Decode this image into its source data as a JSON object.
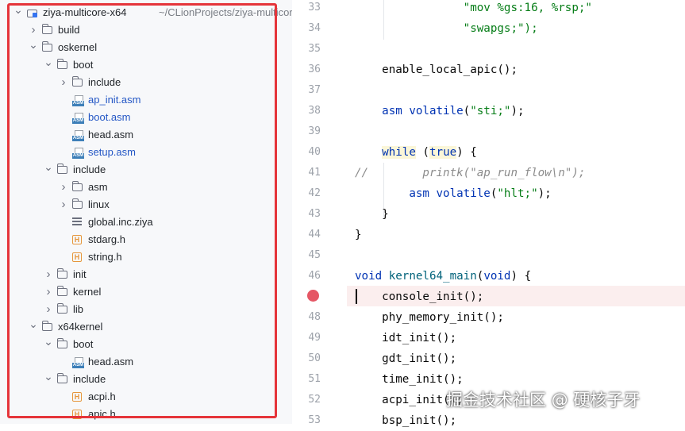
{
  "project_tree": {
    "root_name": "ziya-multicore-x64",
    "root_path": "~/CLionProjects/ziya-multicore",
    "rows": [
      {
        "depth": 0,
        "arrow": "down",
        "icon": "module-icon",
        "label": "ziya-multicore-x64",
        "style": "normal"
      },
      {
        "depth": 1,
        "arrow": "right",
        "icon": "folder-icon",
        "label": "build",
        "style": "normal"
      },
      {
        "depth": 1,
        "arrow": "down",
        "icon": "folder-icon",
        "label": "oskernel",
        "style": "normal"
      },
      {
        "depth": 2,
        "arrow": "down",
        "icon": "folder-icon",
        "label": "boot",
        "style": "normal"
      },
      {
        "depth": 3,
        "arrow": "right",
        "icon": "folder-icon",
        "label": "include",
        "style": "normal"
      },
      {
        "depth": 3,
        "arrow": "none",
        "icon": "asm-file-icon",
        "label": "ap_init.asm",
        "style": "blue"
      },
      {
        "depth": 3,
        "arrow": "none",
        "icon": "asm-file-icon",
        "label": "boot.asm",
        "style": "blue"
      },
      {
        "depth": 3,
        "arrow": "none",
        "icon": "asm-file-icon",
        "label": "head.asm",
        "style": "normal"
      },
      {
        "depth": 3,
        "arrow": "none",
        "icon": "asm-file-icon",
        "label": "setup.asm",
        "style": "blue"
      },
      {
        "depth": 2,
        "arrow": "down",
        "icon": "folder-icon",
        "label": "include",
        "style": "normal"
      },
      {
        "depth": 3,
        "arrow": "right",
        "icon": "folder-icon",
        "label": "asm",
        "style": "normal"
      },
      {
        "depth": 3,
        "arrow": "right",
        "icon": "folder-icon",
        "label": "linux",
        "style": "normal"
      },
      {
        "depth": 3,
        "arrow": "none",
        "icon": "text-file-icon",
        "label": "global.inc.ziya",
        "style": "normal"
      },
      {
        "depth": 3,
        "arrow": "none",
        "icon": "header-file-icon",
        "label": "stdarg.h",
        "style": "normal"
      },
      {
        "depth": 3,
        "arrow": "none",
        "icon": "header-file-icon",
        "label": "string.h",
        "style": "normal"
      },
      {
        "depth": 2,
        "arrow": "right",
        "icon": "folder-icon",
        "label": "init",
        "style": "normal"
      },
      {
        "depth": 2,
        "arrow": "right",
        "icon": "folder-icon",
        "label": "kernel",
        "style": "normal"
      },
      {
        "depth": 2,
        "arrow": "right",
        "icon": "folder-icon",
        "label": "lib",
        "style": "normal"
      },
      {
        "depth": 1,
        "arrow": "down",
        "icon": "folder-icon",
        "label": "x64kernel",
        "style": "normal"
      },
      {
        "depth": 2,
        "arrow": "down",
        "icon": "folder-icon",
        "label": "boot",
        "style": "normal"
      },
      {
        "depth": 3,
        "arrow": "none",
        "icon": "asm-file-icon",
        "label": "head.asm",
        "style": "normal"
      },
      {
        "depth": 2,
        "arrow": "down",
        "icon": "folder-icon",
        "label": "include",
        "style": "normal"
      },
      {
        "depth": 3,
        "arrow": "none",
        "icon": "header-file-icon",
        "label": "acpi.h",
        "style": "normal"
      },
      {
        "depth": 3,
        "arrow": "none",
        "icon": "header-file-icon",
        "label": "apic.h",
        "style": "normal"
      }
    ]
  },
  "editor": {
    "line_numbers": [
      "33",
      "34",
      "35",
      "36",
      "37",
      "38",
      "39",
      "40",
      "41",
      "42",
      "43",
      "44",
      "45",
      "46",
      "47",
      "48",
      "49",
      "50",
      "51",
      "52",
      "53"
    ],
    "breakpoint_line": "47",
    "lines": [
      [
        {
          "t": "                \"mov %gs:16, %rsp;\"",
          "c": "str"
        }
      ],
      [
        {
          "t": "                \"swapgs;\");",
          "c": "str"
        }
      ],
      [],
      [
        {
          "t": "    enable_local_apic();",
          "c": "plain"
        }
      ],
      [],
      [
        {
          "t": "    ",
          "c": "plain"
        },
        {
          "t": "asm volatile",
          "c": "kw"
        },
        {
          "t": "(",
          "c": "plain"
        },
        {
          "t": "\"sti;\"",
          "c": "str"
        },
        {
          "t": ");",
          "c": "plain"
        }
      ],
      [],
      [
        {
          "t": "    ",
          "c": "plain"
        },
        {
          "t": "while",
          "c": "kwhl"
        },
        {
          "t": " (",
          "c": "plain"
        },
        {
          "t": "true",
          "c": "kwhl"
        },
        {
          "t": ") {",
          "c": "plain"
        }
      ],
      [
        {
          "t": "//        printk(\"ap_run_flow\\n\");",
          "c": "cmt"
        }
      ],
      [
        {
          "t": "        ",
          "c": "plain"
        },
        {
          "t": "asm volatile",
          "c": "kw"
        },
        {
          "t": "(",
          "c": "plain"
        },
        {
          "t": "\"hlt;\"",
          "c": "str"
        },
        {
          "t": ");",
          "c": "plain"
        }
      ],
      [
        {
          "t": "    }",
          "c": "plain"
        }
      ],
      [
        {
          "t": "}",
          "c": "plain"
        }
      ],
      [],
      [
        {
          "t": "void",
          "c": "kw"
        },
        {
          "t": " kernel64_main",
          "c": "fnd"
        },
        {
          "t": "(",
          "c": "plain"
        },
        {
          "t": "void",
          "c": "kw"
        },
        {
          "t": ") {",
          "c": "plain"
        }
      ],
      [
        {
          "t": "    console_init();",
          "c": "plain"
        }
      ],
      [
        {
          "t": "    phy_memory_init();",
          "c": "plain"
        }
      ],
      [
        {
          "t": "    idt_init();",
          "c": "plain"
        }
      ],
      [
        {
          "t": "    gdt_init();",
          "c": "plain"
        }
      ],
      [
        {
          "t": "    time_init();",
          "c": "plain"
        }
      ],
      [
        {
          "t": "    acpi_init();",
          "c": "plain"
        }
      ],
      [
        {
          "t": "    bsp_init();",
          "c": "plain"
        }
      ]
    ]
  },
  "watermark": "掘金技术社区 @ 硬核子牙",
  "colors": {
    "highlight_border": "#e5343a",
    "breakpoint": "#e55765",
    "keyword": "#0033b3",
    "string": "#067d17"
  }
}
